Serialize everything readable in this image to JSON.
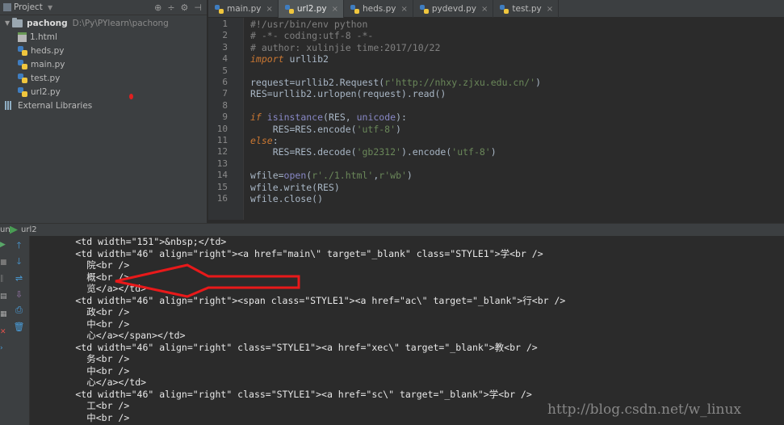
{
  "project": {
    "title": "Project",
    "root_name": "pachong",
    "root_path": "D:\\Py\\PYlearn\\pachong",
    "files": [
      "1.html",
      "heds.py",
      "main.py",
      "test.py",
      "url2.py"
    ],
    "libraries_label": "External Libraries"
  },
  "tabs": [
    {
      "label": "main.py",
      "active": false
    },
    {
      "label": "url2.py",
      "active": true
    },
    {
      "label": "heds.py",
      "active": false
    },
    {
      "label": "pydevd.py",
      "active": false
    },
    {
      "label": "test.py",
      "active": false
    }
  ],
  "editor": {
    "line_numbers": [
      "1",
      "2",
      "3",
      "4",
      "5",
      "6",
      "7",
      "8",
      "9",
      "10",
      "11",
      "12",
      "13",
      "14",
      "15",
      "16"
    ],
    "lines": [
      "#!/usr/bin/env python",
      "# -*- coding:utf-8 -*-",
      "# author: xulinjie time:2017/10/22",
      "import urllib2",
      "",
      "request=urllib2.Request(r'http://nhxy.zjxu.edu.cn/')",
      "RES=urllib2.urlopen(request).read()",
      "",
      "if isinstance(RES, unicode):",
      "    RES=RES.encode('utf-8')",
      "else:",
      "    RES=RES.decode('gb2312').encode('utf-8')",
      "",
      "wfile=open(r'./1.html',r'wb')",
      "wfile.write(RES)",
      "wfile.close()"
    ]
  },
  "run": {
    "label_prefix": "un",
    "config_name": "url2"
  },
  "console": {
    "lines": [
      "        <td width=\"151\">&nbsp;</td>",
      "        <td width=\"46\" align=\"right\"><a href=\"main\\\" target=\"_blank\" class=\"STYLE1\">学<br />",
      "          院<br />",
      "          概<br />",
      "          览</a></td>",
      "        <td width=\"46\" align=\"right\"><span class=\"STYLE1\"><a href=\"ac\\\" target=\"_blank\">行<br />",
      "          政<br />",
      "          中<br />",
      "          心</a></span></td>",
      "        <td width=\"46\" align=\"right\" class=\"STYLE1\"><a href=\"xec\\\" target=\"_blank\">教<br />",
      "          务<br />",
      "          中<br />",
      "          心</a></td>",
      "        <td width=\"46\" align=\"right\" class=\"STYLE1\"><a href=\"sc\\\" target=\"_blank\">学<br />",
      "          工<br />",
      "          中<br />"
    ]
  },
  "watermark": "http://blog.csdn.net/w_linux",
  "colors": {
    "arrow": "#e8191a",
    "keyword": "#cc7832",
    "string": "#6a8759",
    "comment": "#808080"
  }
}
